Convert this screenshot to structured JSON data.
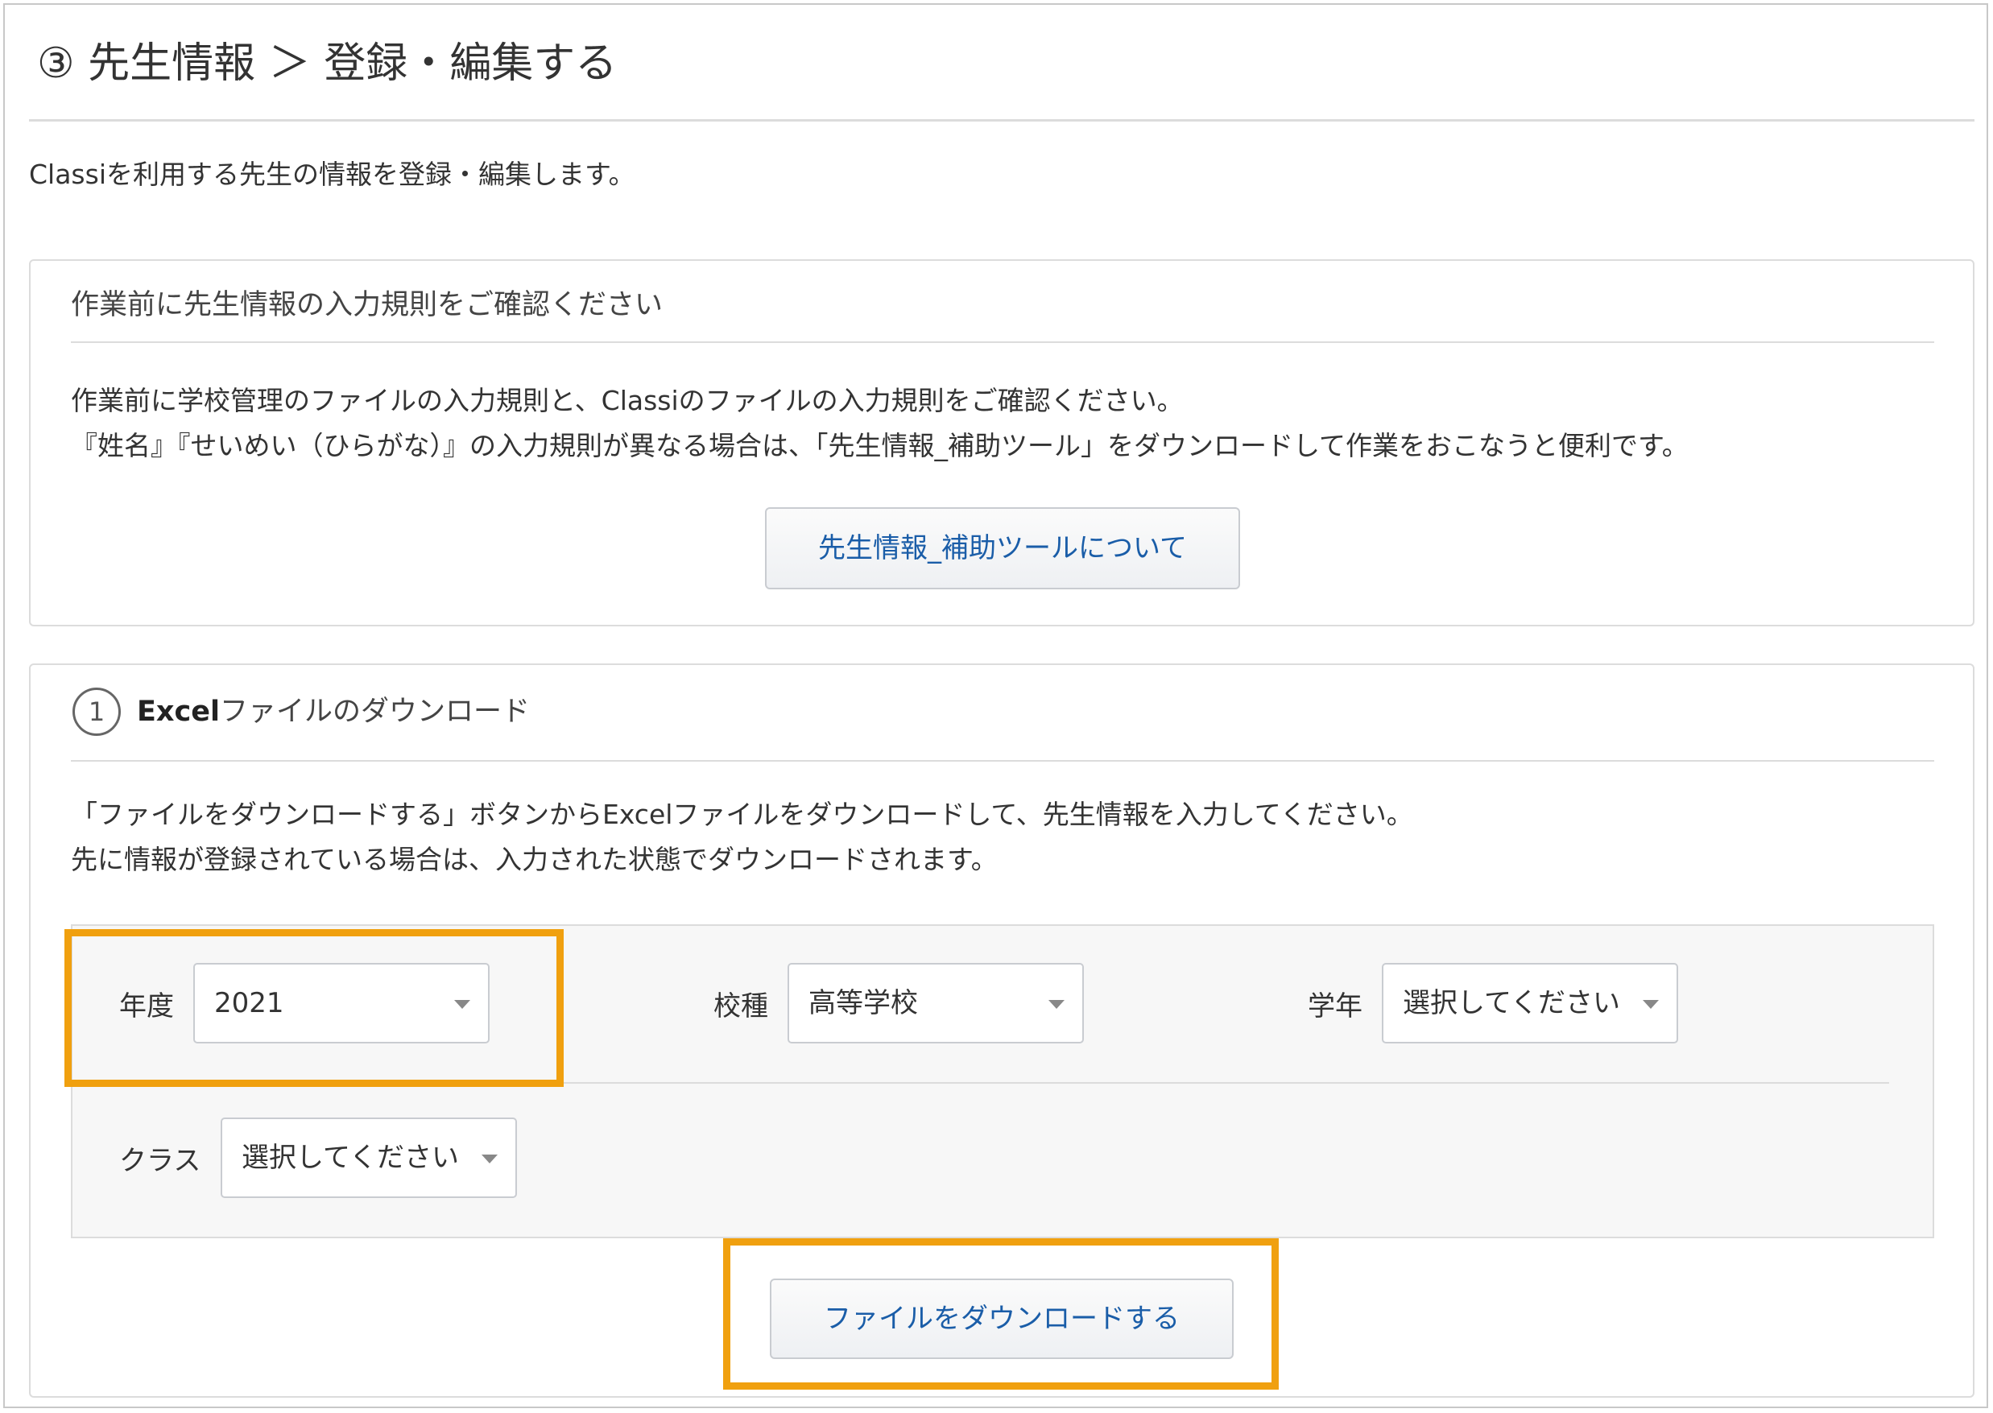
{
  "header": {
    "title": "③ 先生情報 ＞ 登録・編集する",
    "description": "Classiを利用する先生の情報を登録・編集します。"
  },
  "rules_panel": {
    "heading": "作業前に先生情報の入力規則をご確認ください",
    "line1": "作業前に学校管理のファイルの入力規則と、Classiのファイルの入力規則をご確認ください。",
    "line2": "『姓名』『せいめい（ひらがな）』の入力規則が異なる場合は、「先生情報_補助ツール」をダウンロードして作業をおこなうと便利です。",
    "button_label": "先生情報_補助ツールについて"
  },
  "download_panel": {
    "step_number": "1",
    "heading_bold": "Excel",
    "heading_rest": "ファイルのダウンロード",
    "line1": "「ファイルをダウンロードする」ボタンからExcelファイルをダウンロードして、先生情報を入力してください。",
    "line2": "先に情報が登録されている場合は、入力された状態でダウンロードされます。",
    "fields": {
      "year": {
        "label": "年度",
        "value": "2021"
      },
      "school_type": {
        "label": "校種",
        "value": "高等学校"
      },
      "grade": {
        "label": "学年",
        "value": "選択してください"
      },
      "class": {
        "label": "クラス",
        "value": "選択してください"
      }
    },
    "button_label": "ファイルをダウンロードする"
  },
  "colors": {
    "highlight": "#f0a00f",
    "link_text": "#1a5da8"
  }
}
